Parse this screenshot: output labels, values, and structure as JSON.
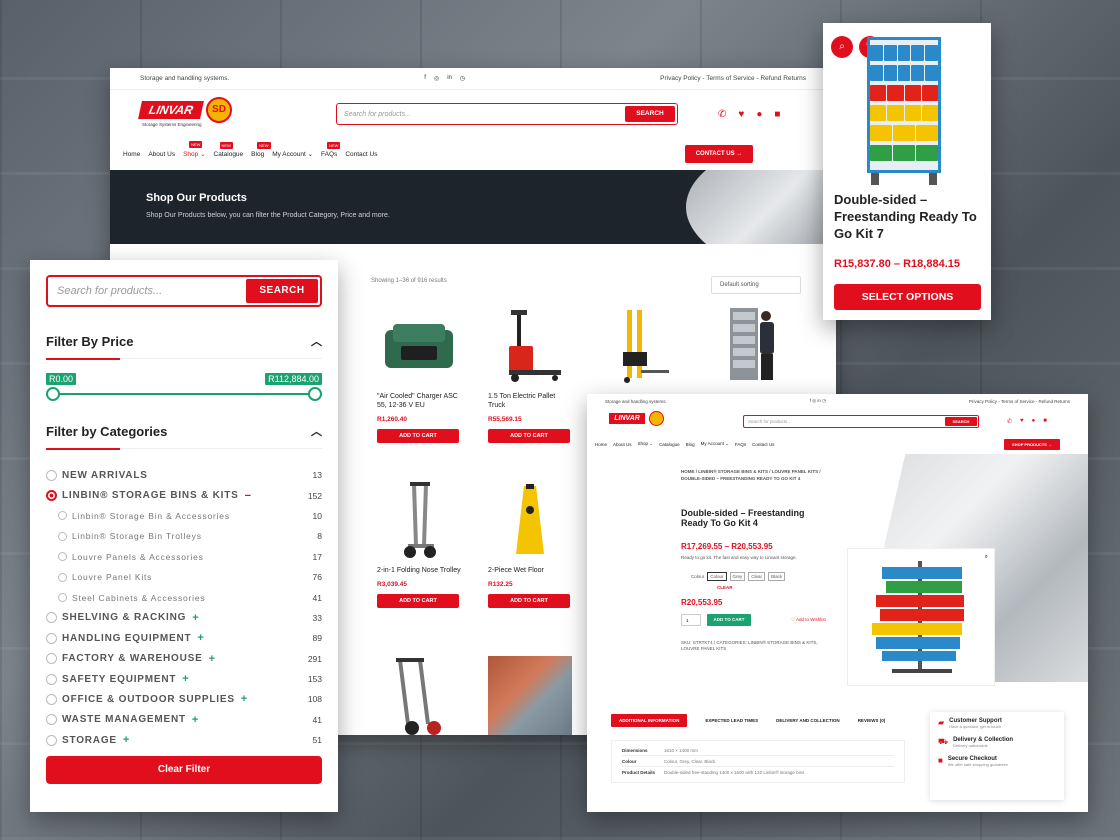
{
  "main": {
    "topbar": {
      "tagline": "Storage and handling systems.",
      "links": "Privacy Policy - Terms of Service - Refund Returns",
      "social": [
        "f",
        "◎",
        "in",
        "◷"
      ]
    },
    "logo": {
      "brand": "LINVAR",
      "badge": "SD",
      "tagline": "Storage Systems Engineering"
    },
    "search": {
      "placeholder": "Search for products...",
      "button": "SEARCH"
    },
    "nav": [
      {
        "label": "Home",
        "new": false
      },
      {
        "label": "About Us",
        "new": false
      },
      {
        "label": "Shop ⌄",
        "new": true,
        "active": true
      },
      {
        "label": "Catalogue",
        "new": true
      },
      {
        "label": "Blog",
        "new": true
      },
      {
        "label": "My Account ⌄",
        "new": false
      },
      {
        "label": "FAQs",
        "new": true
      },
      {
        "label": "Contact Us",
        "new": false
      }
    ],
    "new_badge": "NEW",
    "contact_button": "CONTACT US →",
    "hero": {
      "title": "Shop Our Products",
      "subtitle": "Shop Our Products below, you can filter the Product Category, Price and more."
    },
    "showing": "Showing 1–36 of 916 results",
    "sorting": "Default sorting",
    "add_to_cart": "ADD TO CART",
    "products": [
      {
        "name": "\"Air Cooled\" Charger ASC 55, 12-36 V EU",
        "price": "R1,260.40"
      },
      {
        "name": "1.5 Ton Electric Pallet Truck",
        "price": "R55,569.15"
      },
      {
        "name": "",
        "price": ""
      },
      {
        "name": "",
        "price": ""
      },
      {
        "name": "2-in-1 Folding Nose Trolley",
        "price": "R3,039.45"
      },
      {
        "name": "2-Piece Wet Floor",
        "price": "R132.25"
      }
    ]
  },
  "filter": {
    "search": {
      "placeholder": "Search for products...",
      "button": "SEARCH"
    },
    "price_title": "Filter By Price",
    "price_min": "R0.00",
    "price_max": "R112,884.00",
    "price_low_fraction": 0.0,
    "price_high_fraction": 1.0,
    "categories_title": "Filter by Categories",
    "categories": [
      {
        "label": "NEW ARRIVALS",
        "count": "13",
        "sign": "",
        "level": 0,
        "selected": false
      },
      {
        "label": "LINBIN® STORAGE BINS & KITS",
        "count": "152",
        "sign": "−",
        "level": 0,
        "selected": true
      },
      {
        "label": "Linbin® Storage Bin & Accessories",
        "count": "10",
        "sign": "",
        "level": 1,
        "selected": false
      },
      {
        "label": "Linbin® Storage Bin Trolleys",
        "count": "8",
        "sign": "",
        "level": 1,
        "selected": false
      },
      {
        "label": "Louvre Panels & Accessories",
        "count": "17",
        "sign": "",
        "level": 1,
        "selected": false
      },
      {
        "label": "Louvre Panel Kits",
        "count": "76",
        "sign": "",
        "level": 1,
        "selected": false
      },
      {
        "label": "Steel Cabinets & Accessories",
        "count": "41",
        "sign": "",
        "level": 1,
        "selected": false
      },
      {
        "label": "SHELVING & RACKING",
        "count": "33",
        "sign": "+",
        "level": 0,
        "selected": false
      },
      {
        "label": "HANDLING EQUIPMENT",
        "count": "89",
        "sign": "+",
        "level": 0,
        "selected": false
      },
      {
        "label": "FACTORY & WAREHOUSE",
        "count": "291",
        "sign": "+",
        "level": 0,
        "selected": false
      },
      {
        "label": "SAFETY EQUIPMENT",
        "count": "153",
        "sign": "+",
        "level": 0,
        "selected": false
      },
      {
        "label": "OFFICE & OUTDOOR SUPPLIES",
        "count": "108",
        "sign": "+",
        "level": 0,
        "selected": false
      },
      {
        "label": "WASTE MANAGEMENT",
        "count": "41",
        "sign": "+",
        "level": 0,
        "selected": false
      },
      {
        "label": "STORAGE",
        "count": "51",
        "sign": "+",
        "level": 0,
        "selected": false
      }
    ],
    "clear_button": "Clear Filter"
  },
  "product_card": {
    "icons": [
      "search-icon",
      "heart-icon"
    ],
    "title": "Double-sided – Freestanding Ready To Go Kit 7",
    "price": "R15,837.80 – R18,884.15",
    "button": "SELECT OPTIONS"
  },
  "detail": {
    "topbar": {
      "tagline": "Storage and handling systems.",
      "links": "Privacy Policy - Terms of Service - Refund Returns"
    },
    "search": {
      "placeholder": "Search for products...",
      "button": "SEARCH"
    },
    "nav": [
      "Home",
      "About Us",
      "Shop ⌄",
      "Catalogue",
      "Blog",
      "My Account ⌄",
      "FAQs",
      "Contact Us"
    ],
    "nav_button": "SHOP PRODUCTS →",
    "breadcrumb": "HOME / LINBIN® STORAGE BINS & KITS / LOUVRE PANEL KITS / DOUBLE-SIDED – FREESTANDING READY TO GO KIT 4",
    "title": "Double-sided – Freestanding Ready To Go Kit 4",
    "price_range": "R17,269.55 – R20,553.95",
    "description": "Ready to go kit. The fast and easy way to Linvarit storage.",
    "colour_label": "Colour",
    "colours": [
      "Colour",
      "Grey",
      "Clear",
      "Black"
    ],
    "clear": "CLEAR",
    "price": "R20,553.95",
    "qty": "1",
    "add_to_cart": "ADD TO CART",
    "wishlist": "♡ Add to Wishlist",
    "sku": "SKU: STRTKT4 / CATEGORIES: LINBIN® STORAGE BINS & KITS, LOUVRE PANEL KITS",
    "tabs": [
      "ADDITIONAL INFORMATION",
      "EXPECTED LEAD TIMES",
      "DELIVERY AND COLLECTION",
      "REVIEWS (0)"
    ],
    "info_rows": [
      {
        "k": "Dimensions",
        "v": "1610 × 1400 mm"
      },
      {
        "k": "Colour",
        "v": "Colour, Grey, Clear, Black"
      },
      {
        "k": "Product Details",
        "v": "Double-sided free-standing 1400 x 1600 with 120 Linbin® storage bins"
      }
    ],
    "side": [
      {
        "icon": "chat-icon",
        "title": "Customer Support",
        "sub": "Have a question, get in touch"
      },
      {
        "icon": "truck-icon",
        "title": "Delivery & Collection",
        "sub": "Delivery nationwide"
      },
      {
        "icon": "lock-icon",
        "title": "Secure Checkout",
        "sub": "We offer safe shopping guarantee"
      }
    ]
  }
}
